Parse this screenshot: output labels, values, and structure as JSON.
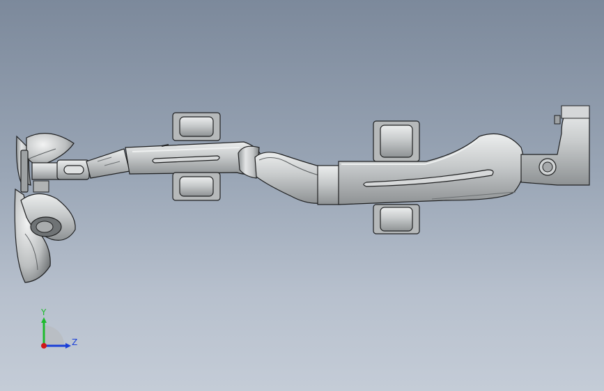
{
  "viewport": {
    "colors": {
      "part_fill": "#c9cccd",
      "part_dark": "#8d9193",
      "part_light": "#e6e8e8",
      "edge": "#1e1f20"
    }
  },
  "triad": {
    "y_label": "Y",
    "z_label": "Z",
    "colors": {
      "y": "#1dbb2c",
      "z": "#1a3fd8",
      "x": "#d01818"
    }
  }
}
